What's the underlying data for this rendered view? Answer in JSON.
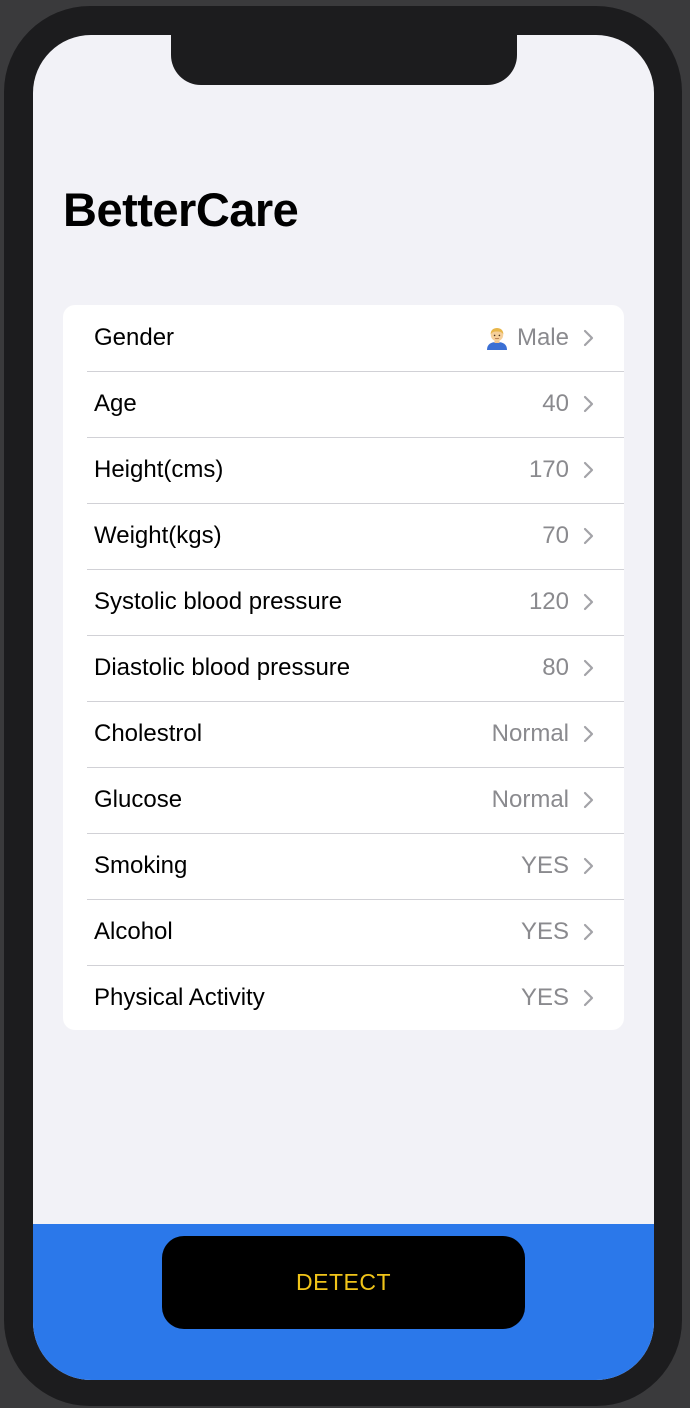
{
  "app": {
    "title": "BetterCare"
  },
  "form": {
    "rows": [
      {
        "label": "Gender",
        "value": "Male",
        "icon": "man-emoji-icon"
      },
      {
        "label": "Age",
        "value": "40"
      },
      {
        "label": "Height(cms)",
        "value": "170"
      },
      {
        "label": "Weight(kgs)",
        "value": "70"
      },
      {
        "label": "Systolic blood pressure",
        "value": "120"
      },
      {
        "label": "Diastolic blood pressure",
        "value": "80"
      },
      {
        "label": "Cholestrol",
        "value": "Normal"
      },
      {
        "label": "Glucose",
        "value": "Normal"
      },
      {
        "label": "Smoking",
        "value": "YES"
      },
      {
        "label": "Alcohol",
        "value": "YES"
      },
      {
        "label": "Physical Activity",
        "value": "YES"
      }
    ]
  },
  "footer": {
    "detect_label": "DETECT"
  },
  "colors": {
    "background": "#f2f2f7",
    "card": "#ffffff",
    "value_text": "#8a8a8e",
    "bottom_bar": "#2b78ea",
    "button_bg": "#000000",
    "button_text": "#f0c419"
  }
}
